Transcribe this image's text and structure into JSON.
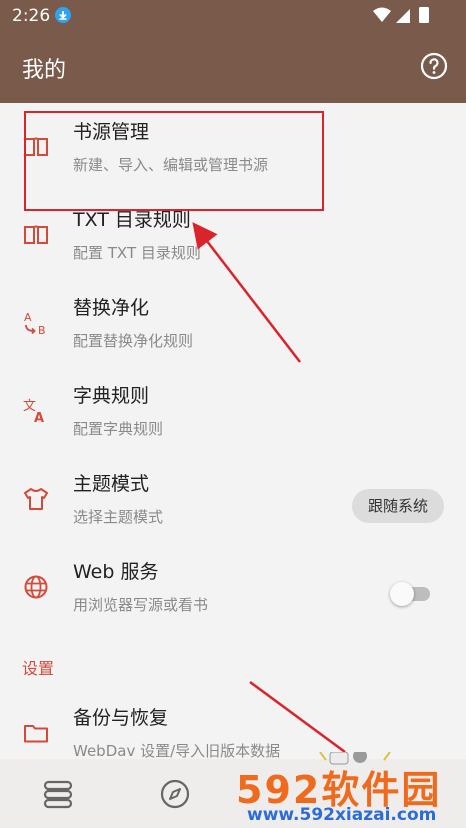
{
  "status_bar": {
    "time": "2:26"
  },
  "app_bar": {
    "title": "我的",
    "help_icon": "help-circle-icon"
  },
  "menu": [
    {
      "title": "书源管理",
      "subtitle": "新建、导入、编辑或管理书源",
      "icon": "book-icon"
    },
    {
      "title": "TXT 目录规则",
      "subtitle": "配置 TXT 目录规则",
      "icon": "book-icon"
    },
    {
      "title": "替换净化",
      "subtitle": "配置替换净化规则",
      "icon": "replace-ab-icon"
    },
    {
      "title": "字典规则",
      "subtitle": "配置字典规则",
      "icon": "translate-icon"
    },
    {
      "title": "主题模式",
      "subtitle": "选择主题模式",
      "icon": "tshirt-icon",
      "value": "跟随系统"
    },
    {
      "title": "Web 服务",
      "subtitle": "用浏览器写源或看书",
      "icon": "globe-icon",
      "toggle": false
    }
  ],
  "section_settings": {
    "label": "设置"
  },
  "backup": {
    "title": "备份与恢复",
    "subtitle": "WebDav 设置/导入旧版本数据",
    "icon": "folder-icon"
  },
  "bottom_nav": {
    "items": [
      "bookshelf-icon",
      "compass-icon"
    ]
  },
  "watermark": {
    "big": "592软件园",
    "small": "www.592xiazai.com"
  },
  "colors": {
    "accent": "#7a5a4b",
    "icon_red": "#d24a3a",
    "highlight": "#d8242a"
  }
}
